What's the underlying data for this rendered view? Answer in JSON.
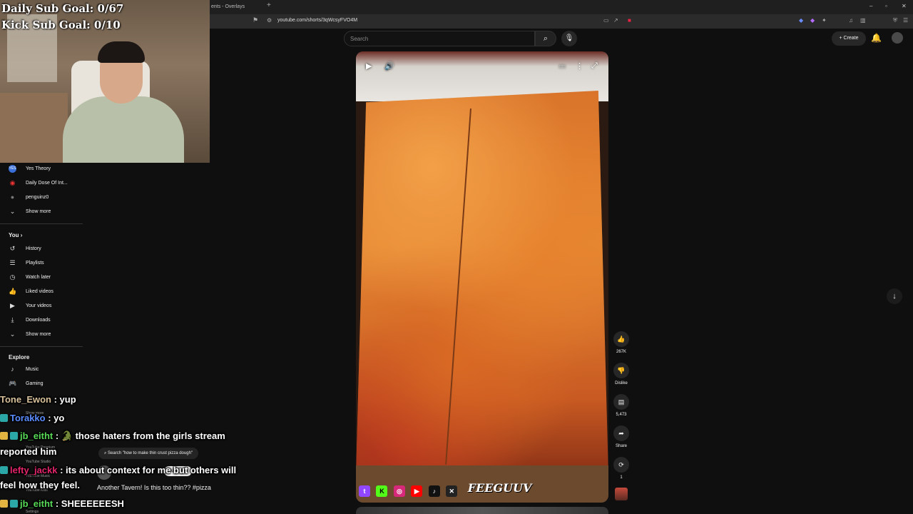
{
  "overlay": {
    "daily_goal": "Daily Sub Goal: 0/67",
    "kick_goal": "Kick Sub Goal: 0/10"
  },
  "browser": {
    "tab_title": "ents - Overlays",
    "url": "youtube.com/shorts/3qWcsyFVO4M",
    "new_tab": "+",
    "window_controls": [
      "–",
      "▫",
      "✕"
    ]
  },
  "header": {
    "search_placeholder": "Search",
    "create_label": "Create"
  },
  "sidebar": {
    "subscriptions": [
      {
        "label": "Yes Theory",
        "icon": "YES"
      },
      {
        "label": "Daily Dose Of Int...",
        "icon": "◉"
      },
      {
        "label": "penguinz0",
        "icon": "●"
      }
    ],
    "show_more_1": "Show more",
    "you_heading": "You",
    "you_items": [
      {
        "label": "History",
        "icon": "↺"
      },
      {
        "label": "Playlists",
        "icon": "☰"
      },
      {
        "label": "Watch later",
        "icon": "◷"
      },
      {
        "label": "Liked videos",
        "icon": "👍"
      },
      {
        "label": "Your videos",
        "icon": "▶"
      },
      {
        "label": "Downloads",
        "icon": "⤓"
      }
    ],
    "show_more_2": "Show more",
    "explore_heading": "Explore",
    "explore_items": [
      {
        "label": "Music",
        "icon": "♪"
      },
      {
        "label": "Gaming",
        "icon": "🎮"
      }
    ],
    "obscured_items": [
      "Show more",
      "YouTube Premium",
      "YouTube Studio",
      "YouTube Music",
      "YouTube Kids",
      "Settings"
    ]
  },
  "chat": [
    {
      "user": "Tone_Ewon",
      "msg": " : yup"
    },
    {
      "user": "Torakko",
      "msg": " : yo"
    },
    {
      "user": "jb_eitht",
      "msg": " : 🐊 those haters from the girls stream"
    },
    {
      "user": "",
      "msg": "reported him"
    },
    {
      "user": "lefty_jackk",
      "msg": " : its about context for me but others will"
    },
    {
      "user": "",
      "msg": "feel how they feel."
    },
    {
      "user": "jb_eitht",
      "msg": " : SHEEEEEESH"
    }
  ],
  "video": {
    "search_suggestion": "Search \"how to make thin crust pizza dough\"",
    "title": "Another Tavern! Is this too thin?? #pizza",
    "subscribe_label": "Subscribe",
    "watermark": "FEEGUUV",
    "social_icons": [
      "twitch",
      "kick",
      "instagram",
      "youtube",
      "tiktok",
      "x"
    ]
  },
  "actions": {
    "likes": "267K",
    "dislike_label": "Dislike",
    "comments": "5,473",
    "share_label": "Share",
    "remix_count": "1"
  }
}
